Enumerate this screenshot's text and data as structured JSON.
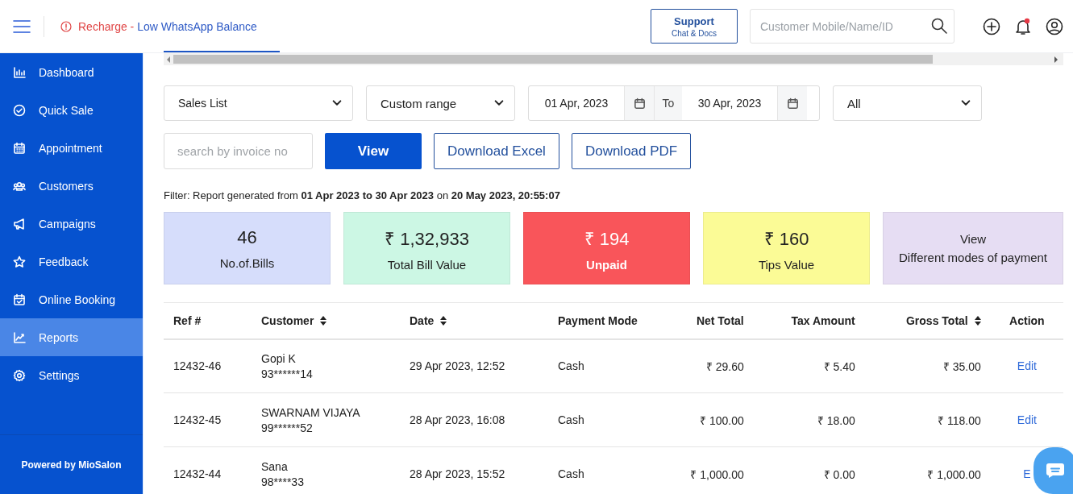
{
  "header": {
    "alert": {
      "prefix": "Recharge",
      "separator": " - ",
      "link": "Low WhatsApp Balance"
    },
    "support": {
      "title": "Support",
      "subtitle": "Chat & Docs"
    },
    "search": {
      "placeholder": "Customer Mobile/Name/ID"
    },
    "has_notification": true
  },
  "sidebar": {
    "items": [
      {
        "label": "Dashboard",
        "selected": false
      },
      {
        "label": "Quick Sale",
        "selected": false
      },
      {
        "label": "Appointment",
        "selected": false
      },
      {
        "label": "Customers",
        "selected": false
      },
      {
        "label": "Campaigns",
        "selected": false
      },
      {
        "label": "Feedback",
        "selected": false
      },
      {
        "label": "Online Booking",
        "selected": false
      },
      {
        "label": "Reports",
        "selected": true
      },
      {
        "label": "Settings",
        "selected": false
      }
    ],
    "footer": "Powered by MioSalon"
  },
  "filters": {
    "report": "Sales List",
    "range": "Custom range",
    "from": "01 Apr, 2023",
    "to_label": "To",
    "to": "30 Apr, 2023",
    "mode": "All",
    "invoice_search": {
      "placeholder": "search by invoice no"
    },
    "buttons": [
      {
        "label": "View",
        "kind": "primary"
      },
      {
        "label": "Download Excel",
        "kind": "outline"
      },
      {
        "label": "Download PDF",
        "kind": "outline"
      }
    ]
  },
  "filter_summary": "Filter: Report generated from **01 Apr 2023 to 30 Apr 2023** on **20 May 2023, 20:55:07**",
  "cards": [
    {
      "value": "46",
      "label": "No.of.Bills",
      "kind": "stat",
      "color": "#d6ddfb"
    },
    {
      "value": "₹ 1,32,933",
      "label": "Total Bill Value",
      "kind": "stat",
      "color": "#ccf7e4"
    },
    {
      "value": "₹ 194",
      "label": "Unpaid",
      "kind": "alert",
      "color": "#f9555a"
    },
    {
      "value": "₹ 160",
      "label": "Tips Value",
      "kind": "stat",
      "color": "#fbfb96"
    },
    {
      "value": "View",
      "label": "Different modes of payment",
      "kind": "link",
      "color": "#e6ddf3"
    }
  ],
  "table": {
    "columns": [
      {
        "label": "Ref #",
        "sortable": false
      },
      {
        "label": "Customer",
        "sortable": true
      },
      {
        "label": "Date",
        "sortable": true
      },
      {
        "label": "Payment Mode",
        "sortable": false
      },
      {
        "label": "Net Total",
        "sortable": false
      },
      {
        "label": "Tax Amount",
        "sortable": false
      },
      {
        "label": "Gross Total",
        "sortable": true
      },
      {
        "label": "Action",
        "sortable": false
      }
    ],
    "rows": [
      {
        "ref": "12432-46",
        "customer": "Gopi K",
        "phone": "93******14",
        "date": "29 Apr 2023, 12:52",
        "mode": "Cash",
        "net": "₹ 29.60",
        "tax": "₹ 5.40",
        "gross": "₹ 35.00",
        "action": "Edit"
      },
      {
        "ref": "12432-45",
        "customer": "SWARNAM VIJAYA",
        "phone": "99******52",
        "date": "28 Apr 2023, 16:08",
        "mode": "Cash",
        "net": "₹ 100.00",
        "tax": "₹ 18.00",
        "gross": "₹ 118.00",
        "action": "Edit"
      },
      {
        "ref": "12432-44",
        "customer": "Sana",
        "phone": "98****33",
        "date": "28 Apr 2023, 15:52",
        "mode": "Cash",
        "net": "₹ 1,000.00",
        "tax": "₹ 0.00",
        "gross": "₹ 1,000.00",
        "action": "E"
      }
    ]
  }
}
